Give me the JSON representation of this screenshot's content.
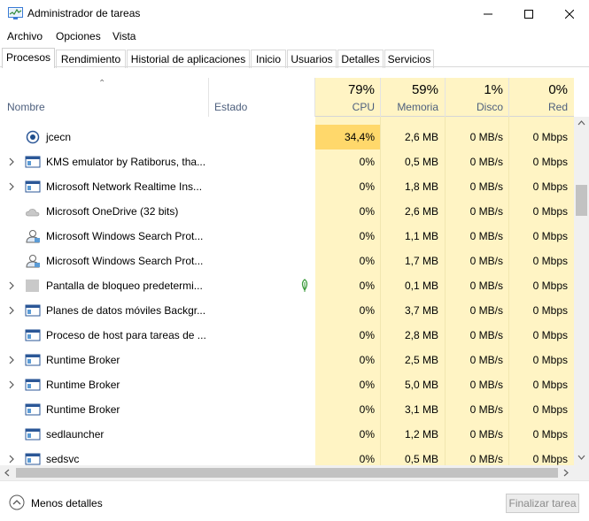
{
  "window": {
    "title": "Administrador de tareas",
    "icon": "task-manager-icon"
  },
  "menu": [
    "Archivo",
    "Opciones",
    "Vista"
  ],
  "tabs": [
    "Procesos",
    "Rendimiento",
    "Historial de aplicaciones",
    "Inicio",
    "Usuarios",
    "Detalles",
    "Servicios"
  ],
  "active_tab": "Procesos",
  "columns": {
    "name": "Nombre",
    "status": "Estado",
    "cpu": {
      "percent": "79%",
      "label": "CPU"
    },
    "memory": {
      "percent": "59%",
      "label": "Memoria"
    },
    "disk": {
      "percent": "1%",
      "label": "Disco"
    },
    "network": {
      "percent": "0%",
      "label": "Red"
    }
  },
  "processes": [
    {
      "name": "jcecn",
      "icon": "jcecn-icon",
      "expandable": false,
      "cpu": "34,4%",
      "memory": "2,6 MB",
      "disk": "0 MB/s",
      "network": "0 Mbps",
      "cpu_highlight": true
    },
    {
      "name": "KMS emulator by Ratiborus, tha...",
      "icon": "window-app-icon",
      "expandable": true,
      "cpu": "0%",
      "memory": "0,5 MB",
      "disk": "0 MB/s",
      "network": "0 Mbps"
    },
    {
      "name": "Microsoft Network Realtime Ins...",
      "icon": "window-app-icon",
      "expandable": true,
      "cpu": "0%",
      "memory": "1,8 MB",
      "disk": "0 MB/s",
      "network": "0 Mbps"
    },
    {
      "name": "Microsoft OneDrive (32 bits)",
      "icon": "onedrive-cloud-icon",
      "expandable": false,
      "cpu": "0%",
      "memory": "2,6 MB",
      "disk": "0 MB/s",
      "network": "0 Mbps"
    },
    {
      "name": "Microsoft Windows Search Prot...",
      "icon": "search-protocol-user-icon",
      "expandable": false,
      "cpu": "0%",
      "memory": "1,1 MB",
      "disk": "0 MB/s",
      "network": "0 Mbps"
    },
    {
      "name": "Microsoft Windows Search Prot...",
      "icon": "search-protocol-user-icon",
      "expandable": false,
      "cpu": "0%",
      "memory": "1,7 MB",
      "disk": "0 MB/s",
      "network": "0 Mbps"
    },
    {
      "name": "Pantalla de bloqueo predetermi...",
      "icon": "gray-square-icon",
      "expandable": true,
      "cpu": "0%",
      "memory": "0,1 MB",
      "disk": "0 MB/s",
      "network": "0 Mbps",
      "status_icon": "leaf-suspended-icon"
    },
    {
      "name": "Planes de datos móviles Backgr...",
      "icon": "window-app-icon",
      "expandable": true,
      "cpu": "0%",
      "memory": "3,7 MB",
      "disk": "0 MB/s",
      "network": "0 Mbps"
    },
    {
      "name": "Proceso de host para tareas de ...",
      "icon": "window-app-icon",
      "expandable": false,
      "cpu": "0%",
      "memory": "2,8 MB",
      "disk": "0 MB/s",
      "network": "0 Mbps"
    },
    {
      "name": "Runtime Broker",
      "icon": "window-app-icon",
      "expandable": true,
      "cpu": "0%",
      "memory": "2,5 MB",
      "disk": "0 MB/s",
      "network": "0 Mbps"
    },
    {
      "name": "Runtime Broker",
      "icon": "window-app-icon",
      "expandable": true,
      "cpu": "0%",
      "memory": "5,0 MB",
      "disk": "0 MB/s",
      "network": "0 Mbps"
    },
    {
      "name": "Runtime Broker",
      "icon": "window-app-icon",
      "expandable": false,
      "cpu": "0%",
      "memory": "3,1 MB",
      "disk": "0 MB/s",
      "network": "0 Mbps"
    },
    {
      "name": "sedlauncher",
      "icon": "window-app-icon",
      "expandable": false,
      "cpu": "0%",
      "memory": "1,2 MB",
      "disk": "0 MB/s",
      "network": "0 Mbps"
    },
    {
      "name": "sedsvc",
      "icon": "window-app-icon",
      "expandable": true,
      "cpu": "0%",
      "memory": "0,5 MB",
      "disk": "0 MB/s",
      "network": "0 Mbps"
    }
  ],
  "footer": {
    "less_details": "Menos detalles",
    "end_task": "Finalizar tarea"
  },
  "colors": {
    "cpu_high": "#ffd86b",
    "usage_low": "#fff4c4",
    "header_label": "#4d5f7d"
  }
}
